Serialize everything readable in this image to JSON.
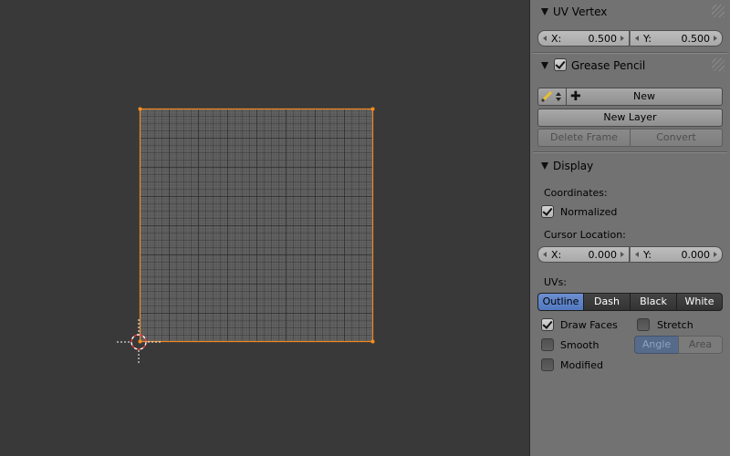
{
  "uv_vertex": {
    "title": "UV Vertex",
    "x_label": "X:",
    "x_value": "0.500",
    "y_label": "Y:",
    "y_value": "0.500"
  },
  "grease_pencil": {
    "title": "Grease Pencil",
    "enabled": true,
    "new_label": "New",
    "new_layer_label": "New Layer",
    "delete_frame_label": "Delete Frame",
    "convert_label": "Convert",
    "icon": "pencil-icon"
  },
  "display": {
    "title": "Display",
    "coordinates_label": "Coordinates:",
    "normalized_label": "Normalized",
    "normalized_checked": true,
    "cursor_location_label": "Cursor Location:",
    "cursor_x_label": "X:",
    "cursor_x_value": "0.000",
    "cursor_y_label": "Y:",
    "cursor_y_value": "0.000",
    "uvs_label": "UVs:",
    "uv_modes": [
      "Outline",
      "Dash",
      "Black",
      "White"
    ],
    "uv_mode_selected": "Outline",
    "draw_faces_label": "Draw Faces",
    "draw_faces_checked": true,
    "stretch_label": "Stretch",
    "stretch_checked": false,
    "smooth_label": "Smooth",
    "smooth_checked": false,
    "modified_label": "Modified",
    "modified_checked": false,
    "stretch_modes": [
      "Angle",
      "Area"
    ],
    "stretch_mode_selected": "Angle"
  },
  "colors": {
    "uv_outline": "#f08a24",
    "panel_bg": "#727272",
    "viewport_bg": "#393939",
    "selected_blue": "#5680c2"
  }
}
